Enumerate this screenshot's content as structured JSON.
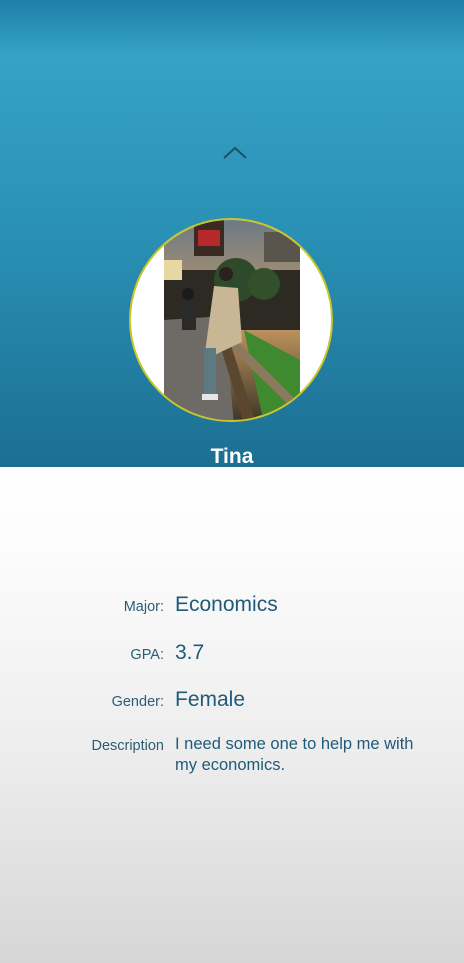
{
  "profile": {
    "name": "Tina"
  },
  "details": {
    "major_label": "Major:",
    "major_value": "Economics",
    "gpa_label": "GPA:",
    "gpa_value": "3.7",
    "gender_label": "Gender:",
    "gender_value": "Female",
    "description_label": "Description",
    "description_value": "I need some one to help me with my economics."
  },
  "colors": {
    "header_top": "#35a3c6",
    "header_bottom": "#1b6f92",
    "avatar_border": "#c8c628",
    "label_text": "#2b5d74",
    "value_text": "#1f5a7a"
  },
  "icons": {
    "collapse": "chevron-up-icon"
  }
}
